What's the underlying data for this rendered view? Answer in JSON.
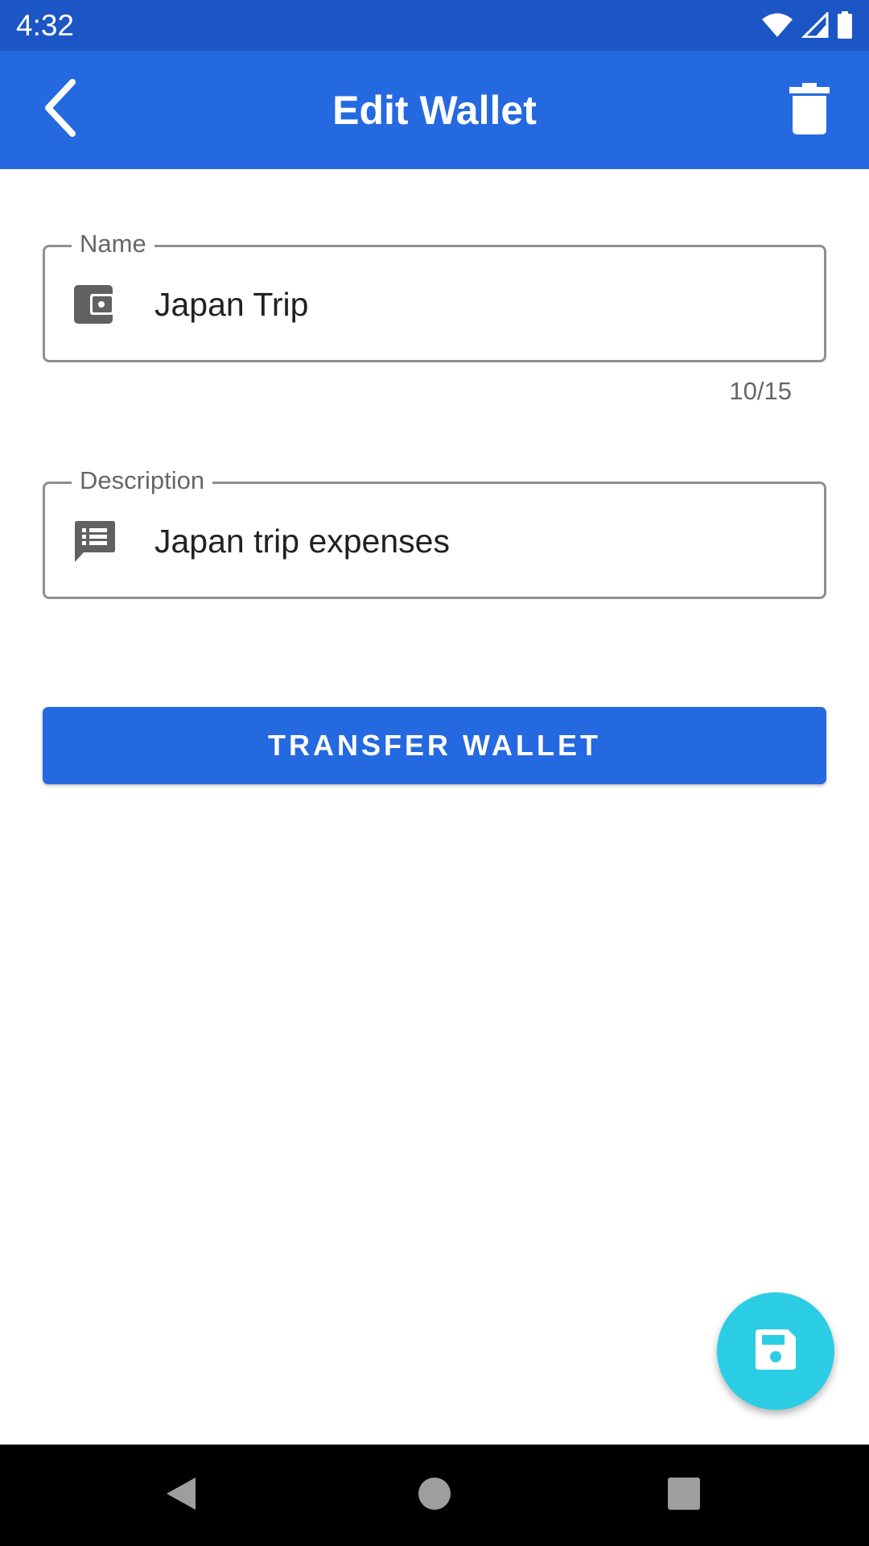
{
  "status_bar": {
    "time": "4:32",
    "icons": [
      "wifi-icon",
      "signal-icon",
      "battery-icon"
    ]
  },
  "app_bar": {
    "title": "Edit Wallet",
    "back_icon": "chevron-left-icon",
    "delete_icon": "trash-icon"
  },
  "form": {
    "name": {
      "label": "Name",
      "value": "Japan Trip",
      "icon": "wallet-icon",
      "counter": "10/15"
    },
    "description": {
      "label": "Description",
      "value": "Japan trip expenses",
      "icon": "comment-list-icon"
    }
  },
  "transfer_button": {
    "label": "TRANSFER WALLET"
  },
  "fab": {
    "icon": "save-icon"
  },
  "nav_bar": {
    "icons": [
      "back-triangle-icon",
      "home-circle-icon",
      "recents-square-icon"
    ]
  },
  "colors": {
    "status_bar": "#1b56c4",
    "primary": "#2569e0",
    "fab": "#2bcde4",
    "outline": "#8f8f8f"
  }
}
